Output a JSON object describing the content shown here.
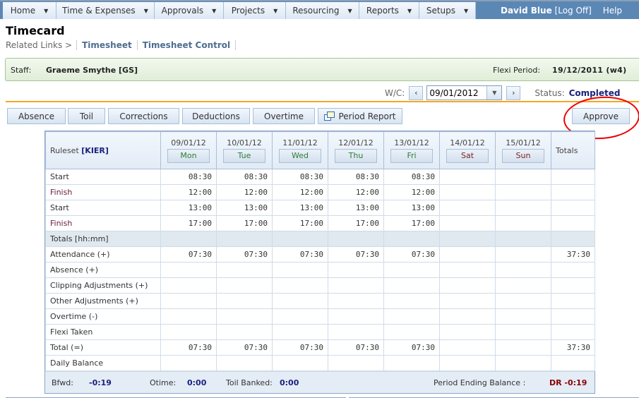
{
  "nav": {
    "menu": [
      {
        "label": "Home"
      },
      {
        "label": "Time & Expenses"
      },
      {
        "label": "Approvals"
      },
      {
        "label": "Projects"
      },
      {
        "label": "Resourcing"
      },
      {
        "label": "Reports"
      },
      {
        "label": "Setups"
      }
    ],
    "user_name": "David Blue",
    "log_off": "[Log Off]",
    "help": "Help",
    "dropdown_icon": "triangle-down-icon"
  },
  "page": {
    "title": "Timecard",
    "related_label": "Related Links >",
    "related_links": [
      "Timesheet",
      "Timesheet Control"
    ]
  },
  "staff": {
    "label": "Staff:",
    "value": "Graeme Smythe [GS]",
    "flexi_label": "Flexi Period:",
    "flexi_value": "19/12/2011 (w4)"
  },
  "week": {
    "label": "W/C:",
    "date": "09/01/2012",
    "prev": "<",
    "next": ">",
    "status_label": "Status:",
    "status_value": "Completed"
  },
  "actions": {
    "absence": "Absence",
    "toil": "Toil",
    "corrections": "Corrections",
    "deductions": "Deductions",
    "overtime": "Overtime",
    "period_report": "Period Report",
    "approve": "Approve"
  },
  "colors": {
    "nav_bg": "#5b87b5",
    "accent_orange": "#f5a623",
    "status_blue": "#1a237e",
    "weekday_green": "#2e7d32",
    "weekend_maroon": "#7b1f1f",
    "debit_red": "#8b0000",
    "highlight_circle": "#e00000"
  },
  "grid": {
    "ruleset_label": "Ruleset",
    "ruleset_code": "[KIER]",
    "totals_header": "Totals",
    "days": [
      {
        "date": "09/01/12",
        "day": "Mon",
        "weekend": false
      },
      {
        "date": "10/01/12",
        "day": "Tue",
        "weekend": false
      },
      {
        "date": "11/01/12",
        "day": "Wed",
        "weekend": false
      },
      {
        "date": "12/01/12",
        "day": "Thu",
        "weekend": false
      },
      {
        "date": "13/01/12",
        "day": "Fri",
        "weekend": false
      },
      {
        "date": "14/01/12",
        "day": "Sat",
        "weekend": true
      },
      {
        "date": "15/01/12",
        "day": "Sun",
        "weekend": true
      }
    ],
    "rows": [
      {
        "label": "Start",
        "values": [
          "08:30",
          "08:30",
          "08:30",
          "08:30",
          "08:30",
          "",
          ""
        ],
        "total": ""
      },
      {
        "label": "Finish",
        "values": [
          "12:00",
          "12:00",
          "12:00",
          "12:00",
          "12:00",
          "",
          ""
        ],
        "total": ""
      },
      {
        "label": "Start",
        "values": [
          "13:00",
          "13:00",
          "13:00",
          "13:00",
          "13:00",
          "",
          ""
        ],
        "total": ""
      },
      {
        "label": "Finish",
        "values": [
          "17:00",
          "17:00",
          "17:00",
          "17:00",
          "17:00",
          "",
          ""
        ],
        "total": ""
      },
      {
        "label": "Totals [hh:mm]",
        "section": true,
        "values": [
          "",
          "",
          "",
          "",
          "",
          "",
          ""
        ],
        "total": ""
      },
      {
        "label": "Attendance (+)",
        "values": [
          "07:30",
          "07:30",
          "07:30",
          "07:30",
          "07:30",
          "",
          ""
        ],
        "total": "37:30"
      },
      {
        "label": "Absence (+)",
        "values": [
          "",
          "",
          "",
          "",
          "",
          "",
          ""
        ],
        "total": ""
      },
      {
        "label": "Clipping Adjustments (+)",
        "values": [
          "",
          "",
          "",
          "",
          "",
          "",
          ""
        ],
        "total": ""
      },
      {
        "label": "Other Adjustments (+)",
        "values": [
          "",
          "",
          "",
          "",
          "",
          "",
          ""
        ],
        "total": ""
      },
      {
        "label": "Overtime (-)",
        "values": [
          "",
          "",
          "",
          "",
          "",
          "",
          ""
        ],
        "total": ""
      },
      {
        "label": "Flexi Taken",
        "values": [
          "",
          "",
          "",
          "",
          "",
          "",
          ""
        ],
        "total": ""
      },
      {
        "label": "Total (=)",
        "values": [
          "07:30",
          "07:30",
          "07:30",
          "07:30",
          "07:30",
          "",
          ""
        ],
        "total": "37:30"
      },
      {
        "label": "Daily Balance",
        "values": [
          "",
          "",
          "",
          "",
          "",
          "",
          ""
        ],
        "total": ""
      }
    ],
    "footer": {
      "bfwd_label": "Bfwd:",
      "bfwd_value": "-0:19",
      "otime_label": "Otime:",
      "otime_value": "0:00",
      "toil_label": "Toil Banked:",
      "toil_value": "0:00",
      "period_label": "Period Ending Balance :",
      "period_value": "DR -0:19"
    }
  }
}
